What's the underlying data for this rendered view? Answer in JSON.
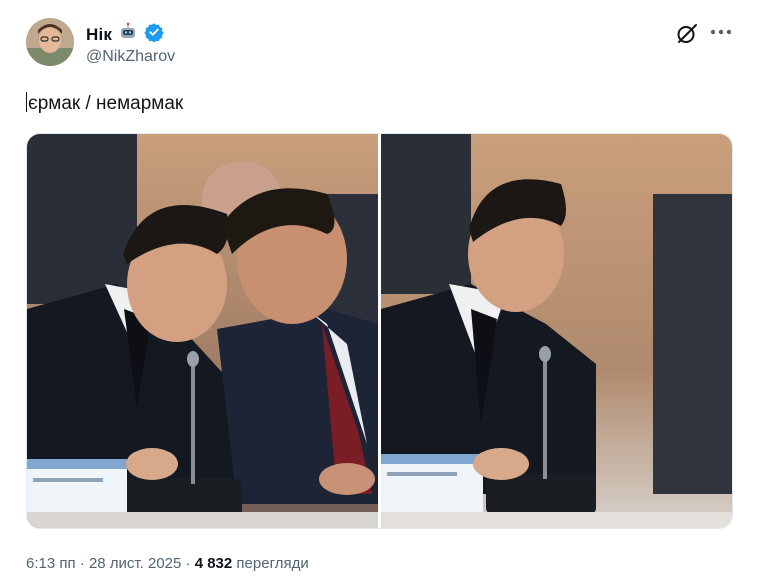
{
  "author": {
    "display_name": "Нік",
    "name_emoji": "robot-emoji",
    "handle": "@NikZharov",
    "verified": true,
    "avatar_icon": "avatar-photo"
  },
  "header_actions": {
    "grok_icon": "grok-icon",
    "more_icon": "more-icon"
  },
  "tweet": {
    "text": "єрмак / немармак"
  },
  "media": [
    {
      "kind": "photo",
      "icon": "photo-two-men-at-table"
    },
    {
      "kind": "photo",
      "icon": "photo-one-man-at-table"
    }
  ],
  "meta": {
    "time": "6:13 пп",
    "separator": " · ",
    "date": "28 лист. 2025",
    "views_count": "4 832",
    "views_label": "перегляди"
  },
  "colors": {
    "verified_blue": "#1d9bf0",
    "secondary_text": "#536471",
    "primary_text": "#0f1419"
  }
}
